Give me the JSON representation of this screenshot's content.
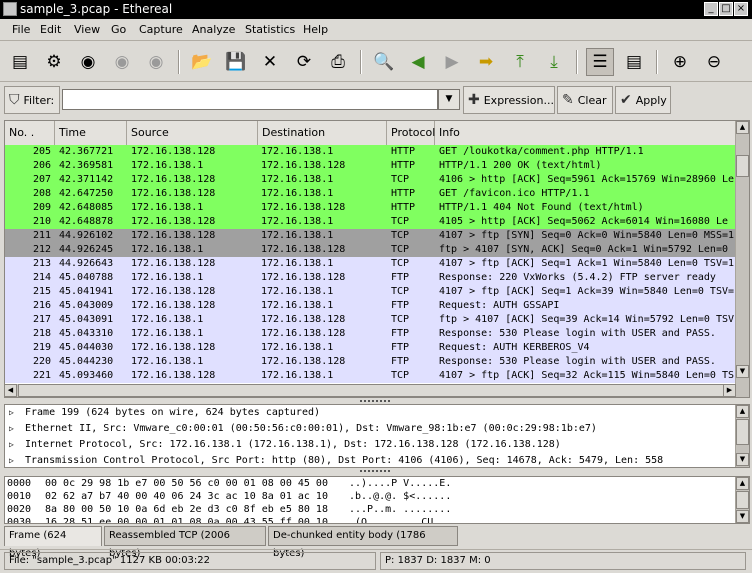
{
  "window": {
    "title": "sample_3.pcap - Ethereal"
  },
  "menu": [
    "File",
    "Edit",
    "View",
    "Go",
    "Capture",
    "Analyze",
    "Statistics",
    "Help"
  ],
  "filter": {
    "label": "Filter:",
    "value": "",
    "expression_label": "Expression...",
    "clear_label": "Clear",
    "apply_label": "Apply"
  },
  "packet_list": {
    "columns": [
      "No. .",
      "Time",
      "Source",
      "Destination",
      "Protocol",
      "Info"
    ],
    "rows": [
      {
        "no": "205",
        "time": "42.367721",
        "src": "172.16.138.128",
        "dst": "172.16.138.1",
        "proto": "HTTP",
        "info": "GET /loukotka/comment.php HTTP/1.1",
        "color": "#80ff60"
      },
      {
        "no": "206",
        "time": "42.369581",
        "src": "172.16.138.1",
        "dst": "172.16.138.128",
        "proto": "HTTP",
        "info": "HTTP/1.1 200 OK (text/html)",
        "color": "#80ff60"
      },
      {
        "no": "207",
        "time": "42.371142",
        "src": "172.16.138.128",
        "dst": "172.16.138.1",
        "proto": "TCP",
        "info": "4106 > http [ACK] Seq=5961 Ack=15769 Win=28960 Le",
        "color": "#80ff60"
      },
      {
        "no": "208",
        "time": "42.647250",
        "src": "172.16.138.128",
        "dst": "172.16.138.1",
        "proto": "HTTP",
        "info": "GET /favicon.ico HTTP/1.1",
        "color": "#80ff60"
      },
      {
        "no": "209",
        "time": "42.648085",
        "src": "172.16.138.1",
        "dst": "172.16.138.128",
        "proto": "HTTP",
        "info": "HTTP/1.1 404 Not Found (text/html)",
        "color": "#80ff60"
      },
      {
        "no": "210",
        "time": "42.648878",
        "src": "172.16.138.128",
        "dst": "172.16.138.1",
        "proto": "TCP",
        "info": "4105 > http [ACK] Seq=5062 Ack=6014 Win=16080 Le",
        "color": "#80ff60"
      },
      {
        "no": "211",
        "time": "44.926102",
        "src": "172.16.138.128",
        "dst": "172.16.138.1",
        "proto": "TCP",
        "info": "4107 > ftp [SYN] Seq=0 Ack=0 Win=5840 Len=0 MSS=1",
        "color": "#a0a0a0"
      },
      {
        "no": "212",
        "time": "44.926245",
        "src": "172.16.138.1",
        "dst": "172.16.138.128",
        "proto": "TCP",
        "info": "ftp > 4107 [SYN, ACK] Seq=0 Ack=1 Win=5792 Len=0",
        "color": "#a0a0a0"
      },
      {
        "no": "213",
        "time": "44.926643",
        "src": "172.16.138.128",
        "dst": "172.16.138.1",
        "proto": "TCP",
        "info": "4107 > ftp [ACK] Seq=1 Ack=1 Win=5840 Len=0 TSV=1",
        "color": "#e0e0ff"
      },
      {
        "no": "214",
        "time": "45.040788",
        "src": "172.16.138.1",
        "dst": "172.16.138.128",
        "proto": "FTP",
        "info": "Response: 220 VxWorks (5.4.2) FTP server ready",
        "color": "#e0e0ff"
      },
      {
        "no": "215",
        "time": "45.041941",
        "src": "172.16.138.128",
        "dst": "172.16.138.1",
        "proto": "TCP",
        "info": "4107 > ftp [ACK] Seq=1 Ack=39 Win=5840 Len=0 TSV=",
        "color": "#e0e0ff"
      },
      {
        "no": "216",
        "time": "45.043009",
        "src": "172.16.138.128",
        "dst": "172.16.138.1",
        "proto": "FTP",
        "info": "Request: AUTH GSSAPI",
        "color": "#e0e0ff"
      },
      {
        "no": "217",
        "time": "45.043091",
        "src": "172.16.138.1",
        "dst": "172.16.138.128",
        "proto": "TCP",
        "info": "ftp > 4107 [ACK] Seq=39 Ack=14 Win=5792 Len=0 TSV",
        "color": "#e0e0ff"
      },
      {
        "no": "218",
        "time": "45.043310",
        "src": "172.16.138.1",
        "dst": "172.16.138.128",
        "proto": "FTP",
        "info": "Response: 530 Please login with USER and PASS.",
        "color": "#e0e0ff"
      },
      {
        "no": "219",
        "time": "45.044030",
        "src": "172.16.138.128",
        "dst": "172.16.138.1",
        "proto": "FTP",
        "info": "Request: AUTH KERBEROS_V4",
        "color": "#e0e0ff"
      },
      {
        "no": "220",
        "time": "45.044230",
        "src": "172.16.138.1",
        "dst": "172.16.138.128",
        "proto": "FTP",
        "info": "Response: 530 Please login with USER and PASS.",
        "color": "#e0e0ff"
      },
      {
        "no": "221",
        "time": "45.093460",
        "src": "172.16.138.128",
        "dst": "172.16.138.1",
        "proto": "TCP",
        "info": "4107 > ftp [ACK] Seq=32 Ack=115 Win=5840 Len=0 TS",
        "color": "#e0e0ff"
      }
    ]
  },
  "details": [
    "Frame 199 (624 bytes on wire, 624 bytes captured)",
    "Ethernet II, Src: Vmware_c0:00:01 (00:50:56:c0:00:01), Dst: Vmware_98:1b:e7 (00:0c:29:98:1b:e7)",
    "Internet Protocol, Src: 172.16.138.1 (172.16.138.1), Dst: 172.16.138.128 (172.16.138.128)",
    "Transmission Control Protocol, Src Port: http (80), Dst Port: 4106 (4106), Seq: 14678, Ack: 5479, Len: 558"
  ],
  "hex": [
    {
      "offset": "0000",
      "bytes": "00 0c 29 98 1b e7 00 50  56 c0 00 01 08 00 45 00",
      "ascii": "..)....P V.....E."
    },
    {
      "offset": "0010",
      "bytes": "02 62 a7 b7 40 00 40 06  24 3c ac 10 8a 01 ac 10",
      "ascii": ".b..@.@. $<......"
    },
    {
      "offset": "0020",
      "bytes": "8a 80 00 50 10 0a 6d eb  2e d3 c0 8f eb e5 80 18",
      "ascii": "...P..m. ........"
    },
    {
      "offset": "0030",
      "bytes": "16 28 51 ee 00 00 01 01  08 0a 00 43 55 ff 00 10",
      "ascii": ".(Q..... ...CU..."
    }
  ],
  "bottom_tabs": [
    "Frame (624 bytes)",
    "Reassembled TCP (2006 bytes)",
    "De-chunked entity body (1786 bytes)"
  ],
  "status": {
    "file": "File: \"sample_3.pcap\" 1127 KB 00:03:22",
    "counts": "P: 1837 D: 1837 M: 0"
  }
}
